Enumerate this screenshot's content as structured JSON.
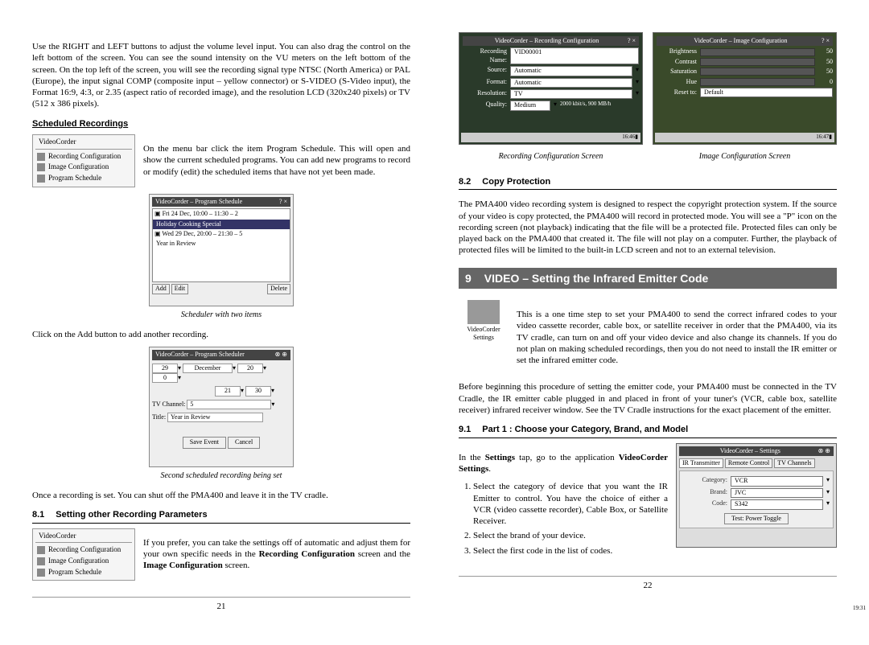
{
  "left": {
    "intro": "Use the RIGHT and LEFT buttons to adjust the volume level input. You can also drag the control on the left bottom of the screen. You can see the sound intensity on the VU meters on the left bottom of the screen. On the top left of the screen, you will see the recording signal type NTSC (North America) or PAL (Europe), the input signal COMP (composite input – yellow connector) or S-VIDEO (S-Video input), the Format 16:9, 4:3, or 2.35 (aspect ratio of recorded image), and the resolution LCD (320x240 pixels) or TV (512 x 386 pixels).",
    "sched_heading": "Scheduled Recordings",
    "menu_title": "VideoCorder",
    "menu1": "Recording Configuration",
    "menu2": "Image Configuration",
    "menu3": "Program Schedule",
    "sched_para": "On the menu bar click the item Program Schedule. This will open and show the current scheduled programs. You can add new programs to record or modify (edit) the scheduled items that have not yet been made.",
    "sched_win_title": "VideoCorder – Program Schedule",
    "sched_item1": "Fri 24 Dec, 10:00 – 11:30 – 2",
    "sched_item1_name": "Holiday Cooking Special",
    "sched_item2": "Wed 29 Dec, 20:00 – 21:30 – 5",
    "sched_item2_name": "Year in Review",
    "btn_add": "Add",
    "btn_edit": "Edit",
    "btn_delete": "Delete",
    "cap1": "Scheduler with two items",
    "add_line": "Click on the Add button to add another recording.",
    "prog_win_title": "VideoCorder – Program Scheduler",
    "prog_date_d": "29",
    "prog_date_m": "December",
    "prog_date_h": "20",
    "prog_date_min": "0",
    "prog_date_h2": "21",
    "prog_date_min2": "30",
    "tvchan_lbl": "TV Channel:",
    "tvchan_val": "5",
    "title_lbl": "Title:",
    "title_val": "Year in Review",
    "btn_save": "Save Event",
    "btn_cancel": "Cancel",
    "cap2": "Second scheduled recording being set",
    "once_line": "Once a recording is set. You can shut off the PMA400 and leave it in the TV cradle.",
    "sec81_num": "8.1",
    "sec81_title": "Setting other Recording Parameters",
    "sec81_para_a": "If you prefer, you can take the settings off of automatic and adjust them for your own specific needs in the ",
    "sec81_bold1": "Recording Configuration",
    "sec81_mid": " screen and the ",
    "sec81_bold2": "Image Configuration",
    "sec81_end": " screen.",
    "page_num": "21"
  },
  "right": {
    "rc_title": "VideoCorder – Recording Configuration",
    "rc_name_lbl": "Recording Name:",
    "rc_name_val": "VID00001",
    "rc_source": "Source:",
    "rc_auto": "Automatic",
    "rc_format": "Format:",
    "rc_res": "Resolution:",
    "rc_res_val": "TV",
    "rc_quality": "Quality:",
    "rc_quality_val": "Medium",
    "rc_bitrate": "2000 kbit/s, 900 MB/h",
    "rc_time": "16:46",
    "rc_cap": "Recording Configuration Screen",
    "ic_title": "VideoCorder – Image Configuration",
    "ic_bright": "Brightness",
    "ic_contrast": "Contrast",
    "ic_sat": "Saturation",
    "ic_hue": "Hue",
    "ic_reset": "Reset to:",
    "ic_default": "Default",
    "ic_v50": "50",
    "ic_v0": "0",
    "ic_time": "16:47",
    "ic_cap": "Image Configuration Screen",
    "sec82_num": "8.2",
    "sec82_title": "Copy Protection",
    "sec82_para": "The PMA400 video recording system is designed to respect the copyright protection system. If the source of your video is copy protected, the PMA400 will record in protected mode. You will see a \"P\" icon on the recording screen (not playback) indicating that the file will be a protected file. Protected files can only be played back on the PMA400 that created it. The file will not play on a computer. Further, the playback of protected files will be limited to the built-in LCD screen and not to an external television.",
    "ch9_num": "9",
    "ch9_title": "VIDEO – Setting the Infrared Emitter Code",
    "vc_icon_lbl": "VideoCorder Settings",
    "ch9_intro": "This is a one time step to set your PMA400 to send the correct infrared codes to your video cassette recorder, cable box, or satellite receiver in order that the PMA400, via its TV cradle, can turn on and off your video device and also change its channels. If you do not plan on making scheduled recordings, then you do not need to install the IR emitter or set the infrared emitter code.",
    "ch9_before": "Before beginning this procedure of setting the emitter code, your PMA400 must be connected in the TV Cradle, the IR emitter cable plugged in and placed in front of your tuner's (VCR, cable box, satellite receiver) infrared receiver window. See the TV Cradle instructions for the exact placement of the emitter.",
    "sec91_num": "9.1",
    "sec91_title": "Part 1 : Choose your Category, Brand, and Model",
    "sec91_intro_a": "In the ",
    "sec91_intro_b": "Settings",
    "sec91_intro_c": " tap, go to the application ",
    "sec91_intro_d": "VideoCorder Settings",
    "sec91_intro_e": ".",
    "li1": "Select the category of device that you want the IR Emitter to control. You have the choice of either a VCR (video cassette recorder), Cable Box, or Satellite Receiver.",
    "li2": "Select the brand of your device.",
    "li3": "Select the first code in the list of codes.",
    "set_title": "VideoCorder – Settings",
    "tab1": "IR Transmitter",
    "tab2": "Remote Control",
    "tab3": "TV Channels",
    "cat_lbl": "Category:",
    "cat_val": "VCR",
    "brand_lbl": "Brand:",
    "brand_val": "JVC",
    "code_lbl": "Code:",
    "code_val": "S342",
    "test_btn": "Test: Power Toggle",
    "set_time": "19:31",
    "page_num": "22"
  }
}
